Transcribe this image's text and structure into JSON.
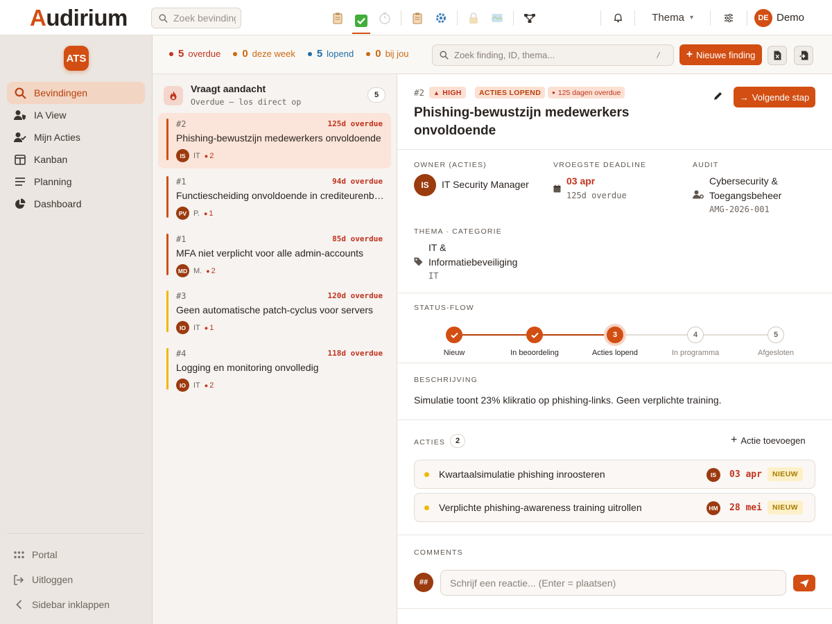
{
  "app": {
    "logo_first": "A",
    "logo_rest": "udirium"
  },
  "topbar": {
    "search_placeholder": "Zoek bevindingen",
    "thema_label": "Thema",
    "user_initials": "DE",
    "user_name": "Demo",
    "tool_icons": [
      "clipboard-icon",
      "check-icon",
      "timer-icon",
      "clipboard-icon",
      "gear-icon",
      "lock-icon",
      "map-icon",
      "share-icon"
    ]
  },
  "sidebar": {
    "badge": "ATS",
    "items": [
      {
        "label": "Bevindingen",
        "icon": "search-icon"
      },
      {
        "label": "IA View",
        "icon": "user-shield-icon"
      },
      {
        "label": "Mijn Acties",
        "icon": "user-check-icon"
      },
      {
        "label": "Kanban",
        "icon": "kanban-icon"
      },
      {
        "label": "Planning",
        "icon": "list-icon"
      },
      {
        "label": "Dashboard",
        "icon": "pie-chart-icon"
      }
    ],
    "bottom": [
      {
        "label": "Portal",
        "icon": "grid-icon"
      },
      {
        "label": "Uitloggen",
        "icon": "logout-icon"
      },
      {
        "label": "Sidebar inklappen",
        "icon": "chevron-left-icon"
      }
    ]
  },
  "filterbar": {
    "stats": [
      {
        "num": "5",
        "label": "overdue",
        "color": "#c0331e"
      },
      {
        "num": "0",
        "label": "deze week",
        "color": "#c96a12"
      },
      {
        "num": "5",
        "label": "lopend",
        "color": "#1f6fa8"
      },
      {
        "num": "0",
        "label": "bij jou",
        "color": "#c96a12"
      }
    ],
    "search_placeholder": "Zoek finding, ID, thema...",
    "search_kbd": "/",
    "new_label": "Nieuwe finding"
  },
  "list": {
    "group_title": "Vraagt aandacht",
    "group_sub": "Overdue — los direct op",
    "group_count": "5",
    "cards": [
      {
        "id": "#2",
        "due": "125d overdue",
        "title": "Phishing-bewustzijn medewerkers onvoldoende",
        "initials": "IS",
        "owner": "IT",
        "count": "2",
        "bar": "#d24e12"
      },
      {
        "id": "#1",
        "due": "94d overdue",
        "title": "Functiescheiding onvoldoende in crediteurenbeheer",
        "initials": "PV",
        "owner": "P.",
        "count": "1",
        "bar": "#d24e12"
      },
      {
        "id": "#1",
        "due": "85d overdue",
        "title": "MFA niet verplicht voor alle admin-accounts",
        "initials": "MD",
        "owner": "M.",
        "count": "2",
        "bar": "#d24e12"
      },
      {
        "id": "#3",
        "due": "120d overdue",
        "title": "Geen automatische patch-cyclus voor servers",
        "initials": "IO",
        "owner": "IT",
        "count": "1",
        "bar": "#f2b705"
      },
      {
        "id": "#4",
        "due": "118d overdue",
        "title": "Logging en monitoring onvolledig",
        "initials": "IO",
        "owner": "IT",
        "count": "2",
        "bar": "#f2b705"
      }
    ]
  },
  "detail": {
    "id": "#2",
    "pills": {
      "high": "HIGH",
      "status": "ACTIES LOPEND",
      "overdue": "125 dagen overdue"
    },
    "title": "Phishing-bewustzijn medewerkers onvoldoende",
    "next_label": "Volgende stap",
    "owner_label": "OWNER (ACTIES)",
    "owner_initials": "IS",
    "owner_name": "IT Security Manager",
    "deadline_label": "VROEGSTE DEADLINE",
    "deadline_value": "03 apr",
    "deadline_sub": "125d overdue",
    "audit_label": "AUDIT",
    "audit_value": "Cybersecurity & Toegangsbeheer",
    "audit_code": "AMG-2026-001",
    "thema_label": "THEMA · CATEGORIE",
    "thema_value": "IT & Informatiebeveiliging",
    "thema_code": "IT",
    "flow_label": "STATUS-FLOW",
    "flow_steps": [
      {
        "num": "1",
        "label": "Nieuw",
        "state": "done"
      },
      {
        "num": "2",
        "label": "In beoordeling",
        "state": "done"
      },
      {
        "num": "3",
        "label": "Acties lopend",
        "state": "current"
      },
      {
        "num": "4",
        "label": "In programma",
        "state": "todo"
      },
      {
        "num": "5",
        "label": "Afgesloten",
        "state": "todo"
      }
    ],
    "desc_label": "BESCHRIJVING",
    "desc_text": "Simulatie toont 23% klikratio op phishing-links. Geen verplichte training.",
    "acties_label": "ACTIES",
    "acties_count": "2",
    "add_actie": "Actie toevoegen",
    "acties": [
      {
        "text": "Kwartaalsimulatie phishing inroosteren",
        "initials": "IS",
        "date": "03 apr",
        "status": "NIEUW"
      },
      {
        "text": "Verplichte phishing-awareness training uitrollen",
        "initials": "HM",
        "date": "28 mei",
        "status": "NIEUW"
      }
    ],
    "comments_label": "COMMENTS",
    "comment_avatar": "##",
    "comment_placeholder": "Schrijf een reactie... (Enter = plaatsen)"
  },
  "colors": {
    "accent": "#d24e12",
    "danger": "#c0331e",
    "warning": "#f2b705"
  }
}
